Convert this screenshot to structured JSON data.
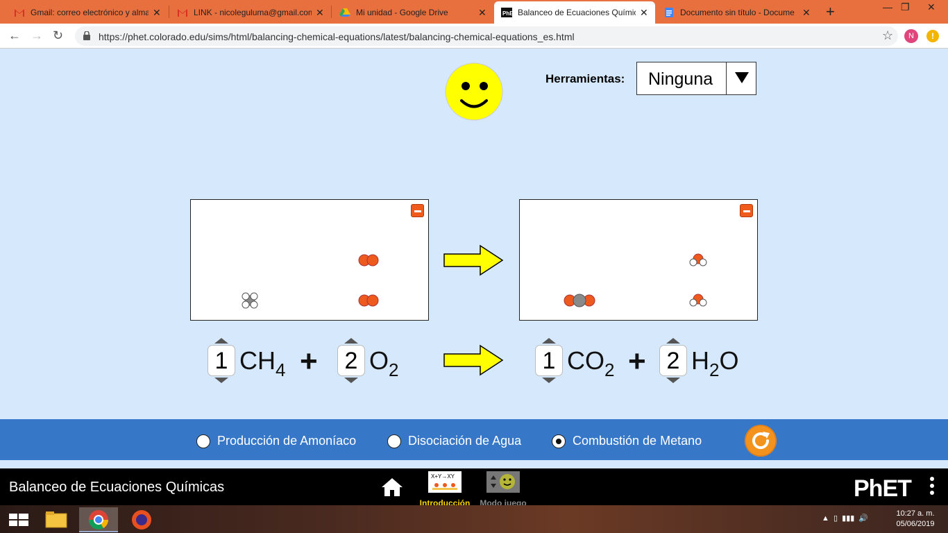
{
  "browser": {
    "tabs": [
      {
        "title": "Gmail: correo electrónico y alma",
        "icon": "gmail-icon"
      },
      {
        "title": "LINK - nicoleguluma@gmail.com",
        "icon": "gmail-icon"
      },
      {
        "title": "Mi unidad - Google Drive",
        "icon": "drive-icon"
      },
      {
        "title": "Balanceo de Ecuaciones Químic",
        "icon": "phet-icon",
        "active": true
      },
      {
        "title": "Documento sin título - Docume",
        "icon": "docs-icon"
      }
    ],
    "url": "https://phet.colorado.edu/sims/html/balancing-chemical-equations/latest/balancing-chemical-equations_es.html",
    "profile_initial": "N",
    "menu_glyph": "!"
  },
  "sim": {
    "tools_label": "Herramientas:",
    "tools_value": "Ninguna",
    "equation": {
      "reactants": [
        {
          "coef": "1",
          "formula": "CH",
          "sub": "4"
        },
        {
          "coef": "2",
          "formula": "O",
          "sub": "2"
        }
      ],
      "products": [
        {
          "coef": "1",
          "formula": "CO",
          "sub": "2"
        },
        {
          "coef": "2",
          "formula_a": "H",
          "sub": "2",
          "formula_b": "O"
        }
      ],
      "plus": "+"
    },
    "molecule_colors": {
      "carbon": "#8a8a8a",
      "oxygen": "#ee5a1e",
      "hydrogen": "#ffffff"
    },
    "reactions": [
      {
        "label": "Producción de Amoníaco",
        "checked": false
      },
      {
        "label": "Disociación de Agua",
        "checked": false
      },
      {
        "label": "Combustión de Metano",
        "checked": true
      }
    ]
  },
  "navbar": {
    "title": "Balanceo de Ecuaciones Químicas",
    "screens": [
      {
        "label": "Introducción",
        "active": true,
        "color": "#ffd700"
      },
      {
        "label": "Modo juego",
        "active": false,
        "color": "#8a8a8a"
      }
    ],
    "logo": "PhET"
  },
  "taskbar": {
    "time": "10:27 a. m.",
    "date": "05/06/2019"
  }
}
